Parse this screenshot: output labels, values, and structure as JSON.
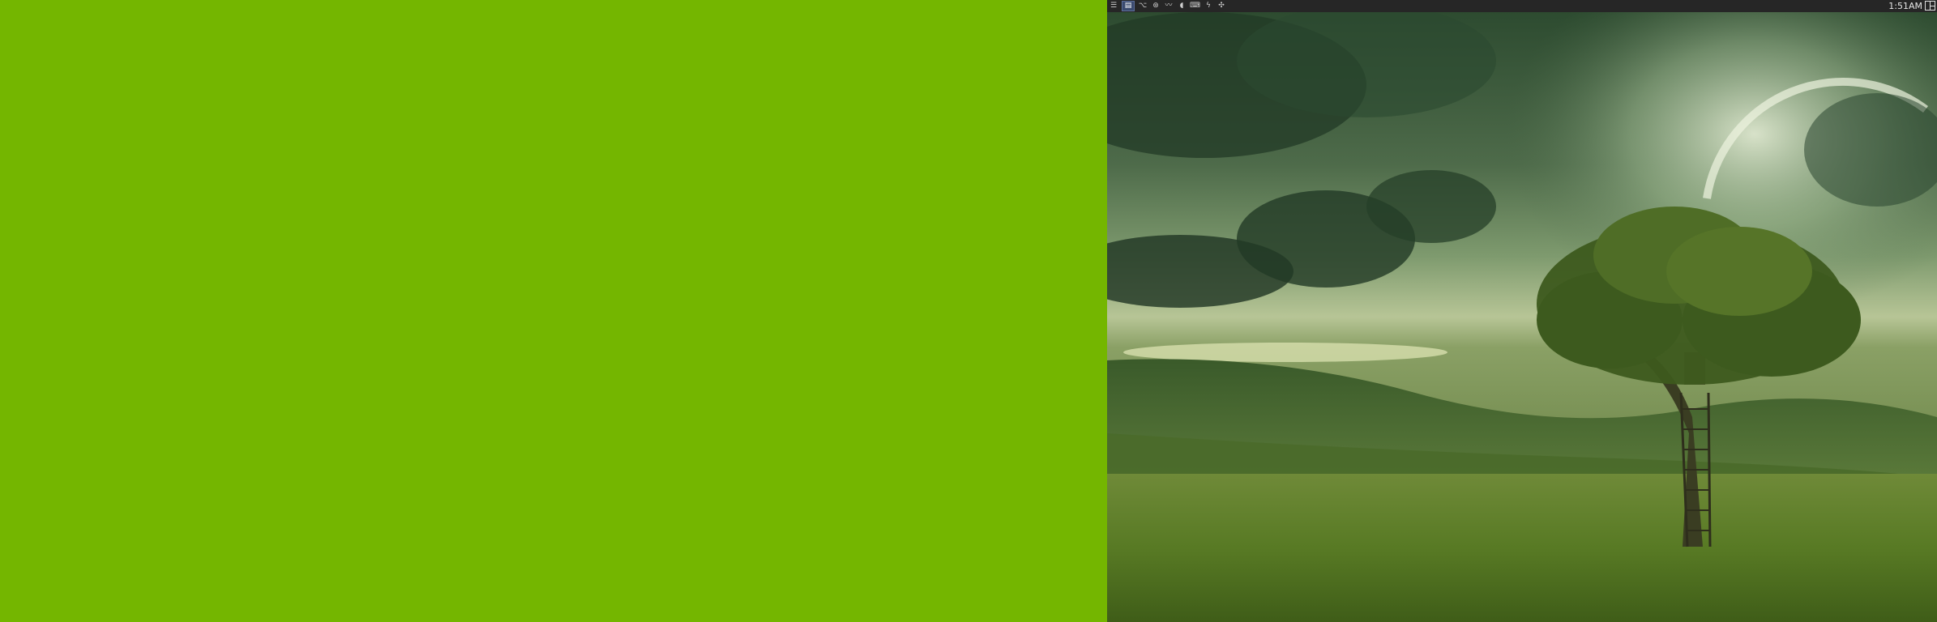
{
  "desktop": {
    "left_background_color": "#74b600"
  },
  "taskbar": {
    "clock": "1:51AM",
    "tray_icons": [
      {
        "name": "window-list-icon",
        "glyph": "☰"
      },
      {
        "name": "terminal-icon",
        "glyph": "▤"
      },
      {
        "name": "branch-icon",
        "glyph": "⌥"
      },
      {
        "name": "browser-icon",
        "glyph": "⊛"
      },
      {
        "name": "network-icon",
        "glyph": "〰"
      },
      {
        "name": "volume-icon",
        "glyph": "🔉"
      },
      {
        "name": "keyboard-icon",
        "glyph": "⌨"
      },
      {
        "name": "power-icon",
        "glyph": "⚡"
      },
      {
        "name": "settings-icon",
        "glyph": "✣"
      }
    ]
  },
  "wallpaper": {
    "description_colors": {
      "sky_dark": "#2c4a2e",
      "sky_light": "#c9d8a8",
      "grass": "#5d7d25"
    }
  }
}
